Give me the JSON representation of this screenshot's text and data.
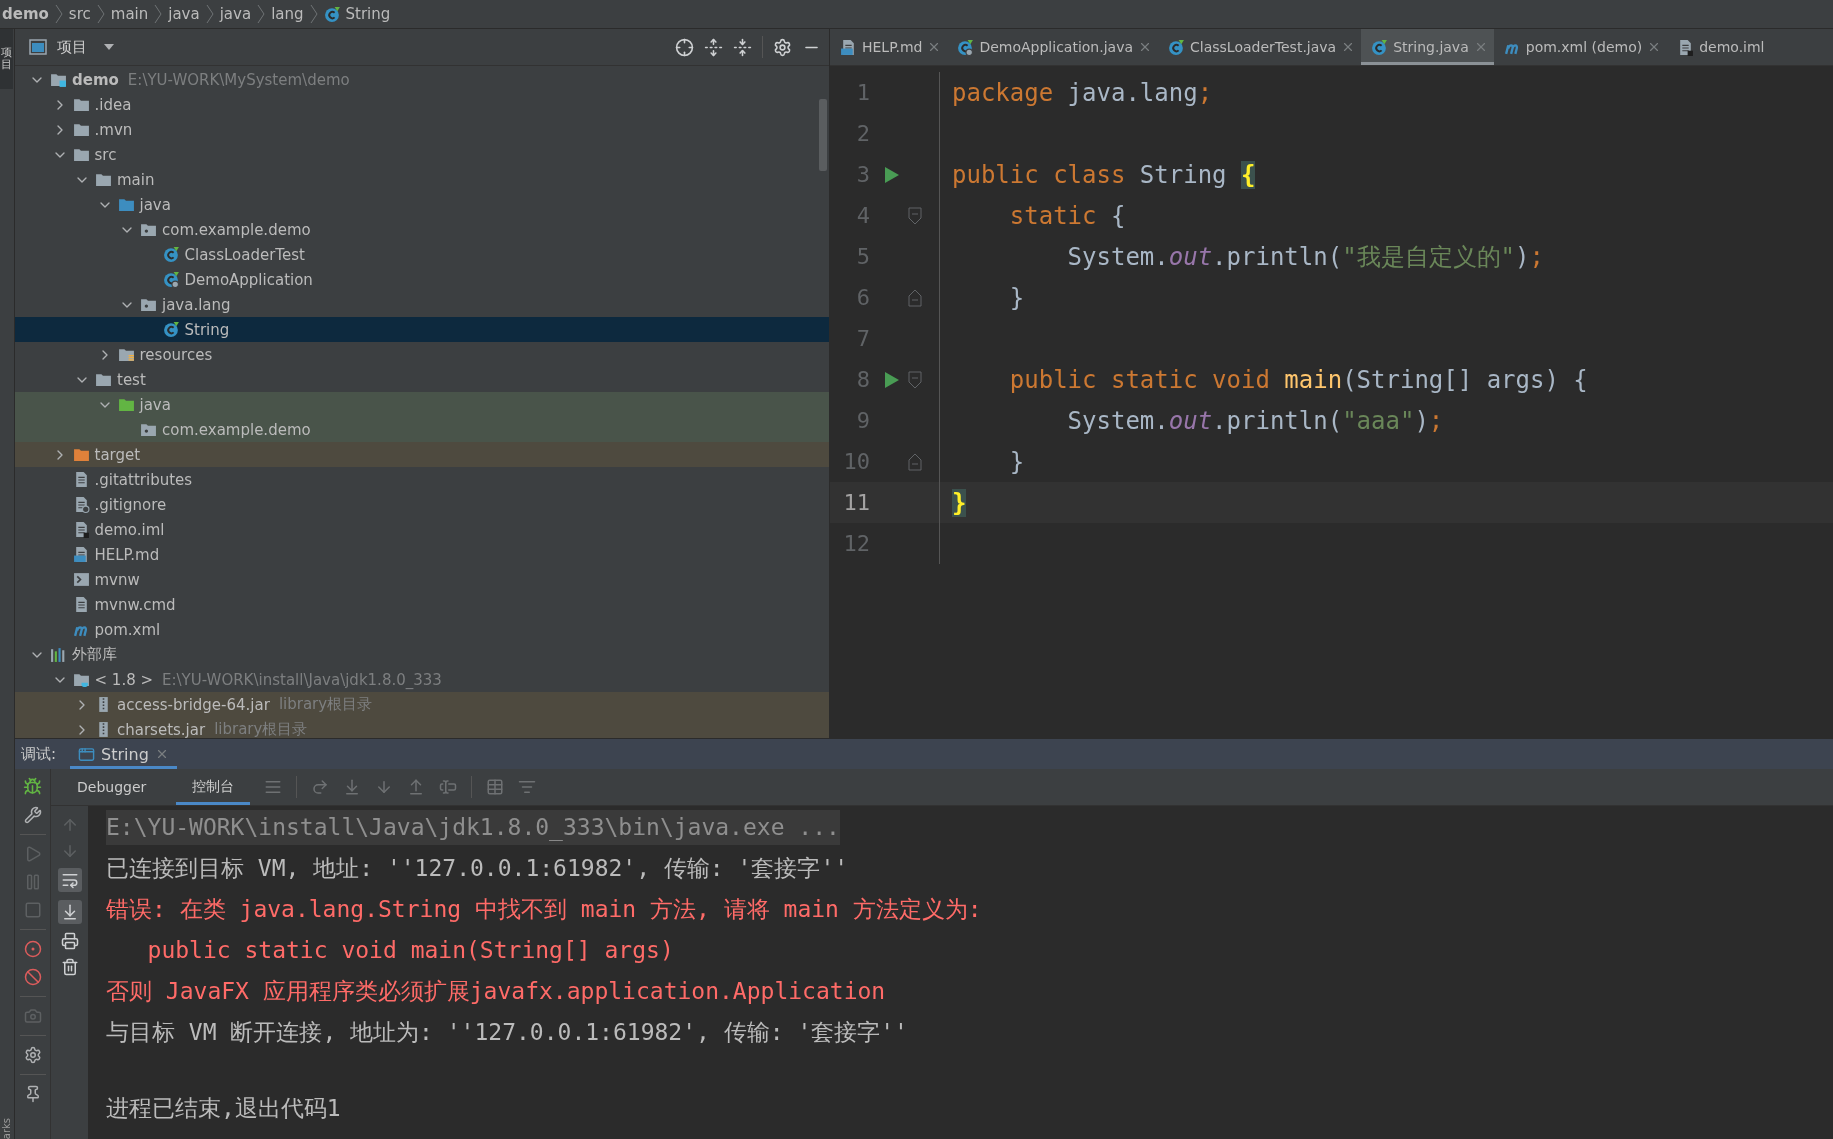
{
  "breadcrumbs": [
    {
      "label": "demo",
      "kind": "module"
    },
    {
      "label": "src",
      "kind": "folder"
    },
    {
      "label": "main",
      "kind": "folder"
    },
    {
      "label": "java",
      "kind": "folder"
    },
    {
      "label": "java",
      "kind": "folder"
    },
    {
      "label": "lang",
      "kind": "folder"
    },
    {
      "label": "String",
      "kind": "class"
    }
  ],
  "left_stripe": {
    "top_tab": "项目",
    "bottom_tab": "arks"
  },
  "project_panel": {
    "title": "项目",
    "tree": [
      {
        "label": "demo",
        "hint": "E:\\YU-WORK\\MySystem\\demo",
        "kind": "module",
        "expanded": true,
        "selected": false,
        "children": [
          {
            "label": ".idea",
            "kind": "folder",
            "expanded": false,
            "selected": false
          },
          {
            "label": ".mvn",
            "kind": "folder",
            "expanded": false,
            "selected": false
          },
          {
            "label": "src",
            "kind": "folder",
            "expanded": true,
            "selected": false,
            "children": [
              {
                "label": "main",
                "kind": "folder",
                "expanded": true,
                "selected": false,
                "children": [
                  {
                    "label": "java",
                    "kind": "source",
                    "expanded": true,
                    "selected": false,
                    "children": [
                      {
                        "label": "com.example.demo",
                        "kind": "package",
                        "expanded": true,
                        "selected": false,
                        "children": [
                          {
                            "label": "ClassLoaderTest",
                            "kind": "class",
                            "selected": false
                          },
                          {
                            "label": "DemoApplication",
                            "kind": "spring",
                            "selected": false
                          }
                        ]
                      },
                      {
                        "label": "java.lang",
                        "kind": "package",
                        "expanded": true,
                        "selected": false,
                        "children": [
                          {
                            "label": "String",
                            "kind": "class",
                            "selected": true
                          }
                        ]
                      }
                    ]
                  },
                  {
                    "label": "resources",
                    "kind": "resources",
                    "expanded": false,
                    "selected": false
                  }
                ]
              },
              {
                "label": "test",
                "kind": "folder",
                "expanded": true,
                "selected": false,
                "children": [
                  {
                    "label": "java",
                    "kind": "test",
                    "color": "#49544a",
                    "expanded": true,
                    "selected": false,
                    "children": [
                      {
                        "label": "com.example.demo",
                        "kind": "package",
                        "color": "#49544a",
                        "selected": false
                      }
                    ]
                  }
                ]
              }
            ]
          },
          {
            "label": "target",
            "kind": "excluded",
            "color": "#4e4a3f",
            "expanded": false,
            "selected": false
          },
          {
            "label": ".gitattributes",
            "kind": "file",
            "selected": false
          },
          {
            "label": ".gitignore",
            "kind": "gitignore",
            "selected": false
          },
          {
            "label": "demo.iml",
            "kind": "iml",
            "selected": false
          },
          {
            "label": "HELP.md",
            "kind": "md",
            "selected": false
          },
          {
            "label": "mvnw",
            "kind": "shell",
            "selected": false
          },
          {
            "label": "mvnw.cmd",
            "kind": "file",
            "selected": false
          },
          {
            "label": "pom.xml",
            "kind": "maven",
            "selected": false
          }
        ]
      },
      {
        "label": "外部库",
        "kind": "libraries",
        "expanded": true,
        "selected": false,
        "children": [
          {
            "label": "< 1.8 >",
            "hint": "E:\\YU-WORK\\install\\Java\\jdk1.8.0_333",
            "kind": "jdk",
            "expanded": true,
            "selected": false,
            "children": [
              {
                "label": "access-bridge-64.jar",
                "hint": "library根目录",
                "kind": "jar",
                "color": "#4e4a3f",
                "expanded": false,
                "selected": false
              },
              {
                "label": "charsets.jar",
                "hint": "library根目录",
                "kind": "jar",
                "color": "#4e4a3f",
                "expanded": false,
                "selected": false
              }
            ]
          }
        ]
      }
    ]
  },
  "editor": {
    "tabs": [
      {
        "label": "HELP.md",
        "kind": "md",
        "selected": false
      },
      {
        "label": "DemoApplication.java",
        "kind": "spring",
        "selected": false
      },
      {
        "label": "ClassLoaderTest.java",
        "kind": "class",
        "selected": false
      },
      {
        "label": "String.java",
        "kind": "class",
        "selected": true
      },
      {
        "label": "pom.xml (demo)",
        "kind": "maven",
        "selected": false
      },
      {
        "label": "demo.iml",
        "kind": "iml",
        "selected": false
      }
    ],
    "lines": [
      {
        "number": "1",
        "run": false,
        "current": false,
        "fold_start": false,
        "fold_end": false,
        "tokens": [
          {
            "kind": "keyword",
            "text": "package "
          },
          {
            "kind": "plain",
            "text": "java.lang"
          },
          {
            "kind": "keyword",
            "text": ";"
          }
        ]
      },
      {
        "number": "2",
        "run": false,
        "current": false,
        "fold_start": false,
        "fold_end": false
      },
      {
        "number": "3",
        "run": true,
        "current": false,
        "fold_start": false,
        "fold_end": false,
        "tokens": [
          {
            "kind": "keyword",
            "text": "public class "
          },
          {
            "kind": "plain",
            "text": "String "
          },
          {
            "kind": "brace",
            "text": "{"
          }
        ]
      },
      {
        "number": "4",
        "run": false,
        "current": false,
        "fold_start": true,
        "fold_end": false,
        "tokens": [
          {
            "kind": "keyword",
            "text": "    static "
          },
          {
            "kind": "plain",
            "text": "{"
          }
        ]
      },
      {
        "number": "5",
        "run": false,
        "current": false,
        "fold_start": false,
        "fold_end": false,
        "tokens": [
          {
            "kind": "plain",
            "text": "        System."
          },
          {
            "kind": "field",
            "text": "out"
          },
          {
            "kind": "plain",
            "text": ".println("
          },
          {
            "kind": "string",
            "text": "\"我是自定义的\""
          },
          {
            "kind": "plain",
            "text": ")"
          },
          {
            "kind": "keyword",
            "text": ";"
          }
        ]
      },
      {
        "number": "6",
        "run": false,
        "current": false,
        "fold_start": false,
        "fold_end": true,
        "tokens": [
          {
            "kind": "plain",
            "text": "    }"
          }
        ]
      },
      {
        "number": "7",
        "run": false,
        "current": false,
        "fold_start": false,
        "fold_end": false
      },
      {
        "number": "8",
        "run": true,
        "current": false,
        "fold_start": true,
        "fold_end": false,
        "tokens": [
          {
            "kind": "keyword",
            "text": "    public static void "
          },
          {
            "kind": "method",
            "text": "main"
          },
          {
            "kind": "plain",
            "text": "(String[] args) {"
          }
        ]
      },
      {
        "number": "9",
        "run": false,
        "current": false,
        "fold_start": false,
        "fold_end": false,
        "tokens": [
          {
            "kind": "plain",
            "text": "        System."
          },
          {
            "kind": "field",
            "text": "out"
          },
          {
            "kind": "plain",
            "text": ".println("
          },
          {
            "kind": "string",
            "text": "\"aaa\""
          },
          {
            "kind": "plain",
            "text": ")"
          },
          {
            "kind": "keyword",
            "text": ";"
          }
        ]
      },
      {
        "number": "10",
        "run": false,
        "current": false,
        "fold_start": false,
        "fold_end": true,
        "tokens": [
          {
            "kind": "plain",
            "text": "    }"
          }
        ]
      },
      {
        "number": "11",
        "run": false,
        "current": true,
        "fold_start": false,
        "fold_end": false,
        "tokens": [
          {
            "kind": "brace",
            "text": "}"
          }
        ]
      },
      {
        "number": "12",
        "run": false,
        "current": false,
        "fold_start": false,
        "fold_end": false
      }
    ]
  },
  "debug": {
    "label": "调试:",
    "session_tab": {
      "label": "String",
      "selected": true
    },
    "tabs": [
      {
        "label": "Debugger",
        "selected": false
      },
      {
        "label": "控制台",
        "selected": true
      }
    ],
    "console": [
      {
        "kind": "command",
        "text": "E:\\YU-WORK\\install\\Java\\jdk1.8.0_333\\bin\\java.exe ..."
      },
      {
        "kind": "info",
        "text": "已连接到目标 VM, 地址: ''127.0.0.1:61982', 传输: '套接字''"
      },
      {
        "kind": "error",
        "text": "错误: 在类 java.lang.String 中找不到 main 方法, 请将 main 方法定义为:"
      },
      {
        "kind": "error",
        "text": "   public static void main(String[] args)"
      },
      {
        "kind": "error",
        "text": "否则 JavaFX 应用程序类必须扩展javafx.application.Application"
      },
      {
        "kind": "info",
        "text": "与目标 VM 断开连接, 地址为: ''127.0.0.1:61982', 传输: '套接字''"
      },
      {
        "kind": "exit",
        "text": "进程已结束,退出代码1"
      }
    ]
  }
}
